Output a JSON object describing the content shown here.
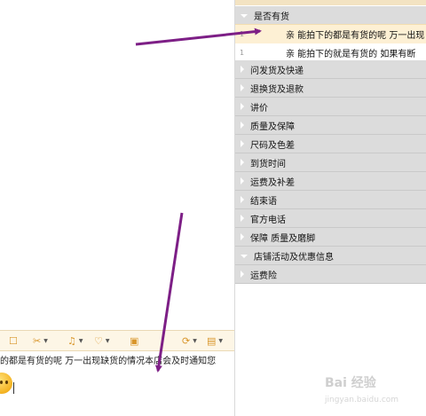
{
  "chat": {
    "message": "的都是有货的呢 万一出现缺货的情况本店会及时通知您",
    "toolbar": [
      "checkbox-icon",
      "scissors-icon",
      "bell-icon",
      "heart-icon",
      "save-icon",
      "chat-icon",
      "doc-icon"
    ]
  },
  "phrases": {
    "groups": [
      {
        "label": "是否有货",
        "expanded": true
      },
      {
        "label": "问发货及快递"
      },
      {
        "label": "退换货及退款"
      },
      {
        "label": "讲价"
      },
      {
        "label": "质量及保障"
      },
      {
        "label": "尺码及色差"
      },
      {
        "label": "到货时间"
      },
      {
        "label": "运费及补差"
      },
      {
        "label": "结束语"
      },
      {
        "label": "官方电话"
      },
      {
        "label": "保障 质量及磨脚"
      },
      {
        "label": "店铺活动及优惠信息",
        "expanded": true
      },
      {
        "label": "运费险"
      }
    ],
    "items": [
      {
        "num": "1",
        "text": "亲 能拍下的都是有货的呢 万一出现"
      },
      {
        "num": "1",
        "text": "亲 能拍下的就是有货的 如果有断"
      }
    ]
  },
  "watermark": {
    "text": "Bai 经验",
    "sub": "jingyan.baidu.com"
  },
  "colors": {
    "arrow": "#7d1f86",
    "toolbar_icon": "#d9962b",
    "group_bg": "#dcdcdc",
    "selected_bg": "#fdf0d4"
  }
}
